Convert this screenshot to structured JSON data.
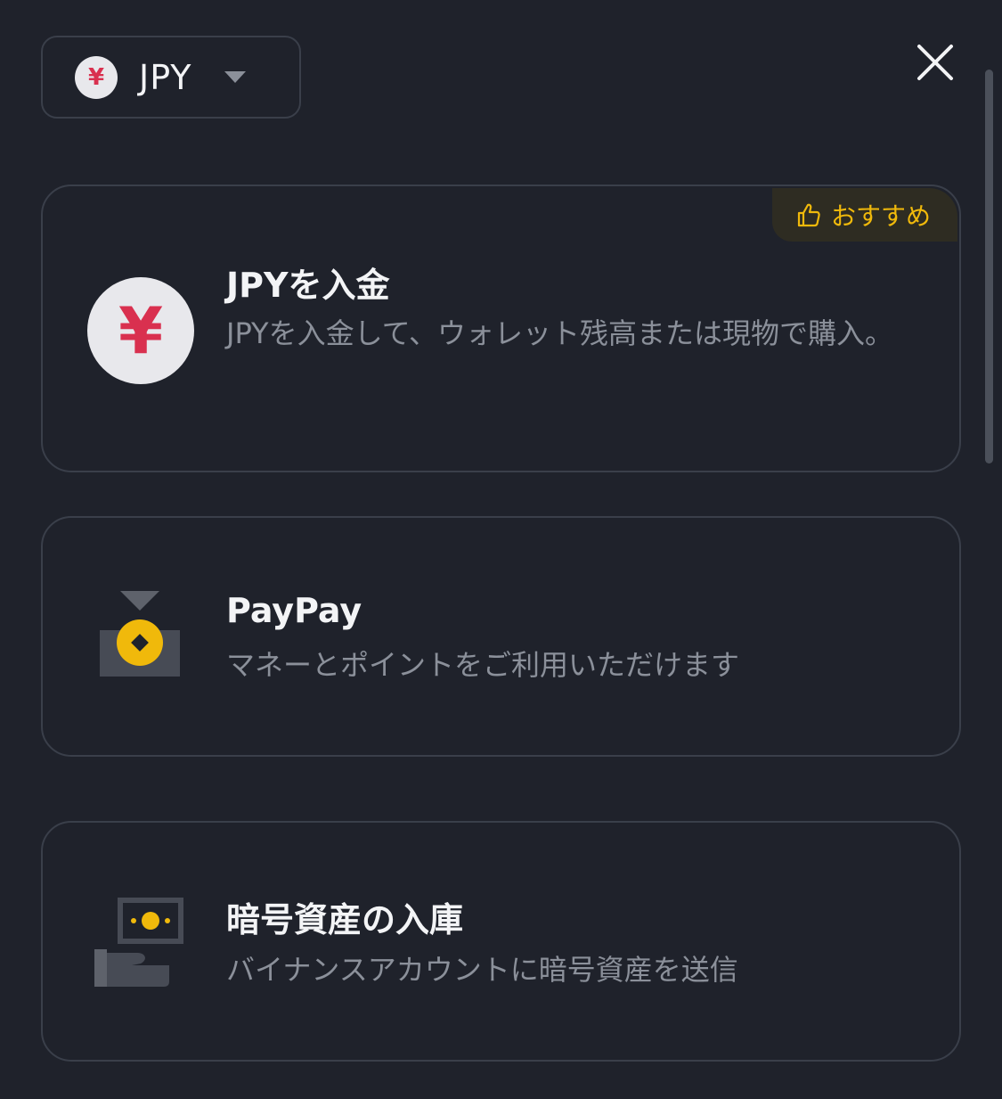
{
  "currency": {
    "symbol": "¥",
    "code": "JPY",
    "icon": "yen-coin-icon"
  },
  "close_icon": "close-icon",
  "options": [
    {
      "title": "JPYを入金",
      "description": "JPYを入金して、ウォレット残高または現物で購入。",
      "badge": "おすすめ",
      "badge_icon": "thumbs-up-icon",
      "icon": "yen-coin-icon",
      "icon_symbol": "¥"
    },
    {
      "title": "PayPay",
      "description": "マネーとポイントをご利用いただけます",
      "icon": "paypay-icon"
    },
    {
      "title": "暗号資産の入庫",
      "description": "バイナンスアカウントに暗号資産を送信",
      "icon": "crypto-deposit-icon"
    }
  ],
  "colors": {
    "background": "#1f222b",
    "accent": "#f0b90b",
    "yen_red": "#d9304f",
    "muted_text": "#8b909a"
  }
}
